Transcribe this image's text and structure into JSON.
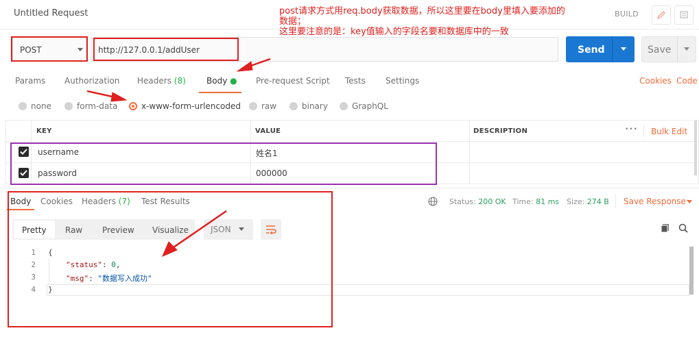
{
  "request": {
    "title": "Untitled Request",
    "build_label": "BUILD",
    "method": "POST",
    "url": "http://127.0.0.1/addUser",
    "send_label": "Send",
    "save_label": "Save"
  },
  "annotation": {
    "line1": "post请求方式用req.body获取数据，所以这里要在body里填入要添加的数据；",
    "line2": "这里要注意的是：key值输入的字段名要和数据库中的一致"
  },
  "tabs": {
    "params": "Params",
    "authorization": "Authorization",
    "headers": "Headers",
    "headers_count": "(8)",
    "body": "Body",
    "prerequest": "Pre-request Script",
    "tests": "Tests",
    "settings": "Settings",
    "cookies": "Cookies",
    "code": "Code"
  },
  "body_types": {
    "none": "none",
    "form_data": "form-data",
    "urlencoded": "x-www-form-urlencoded",
    "raw": "raw",
    "binary": "binary",
    "graphql": "GraphQL",
    "selected": "x-www-form-urlencoded"
  },
  "table": {
    "col_key": "KEY",
    "col_value": "VALUE",
    "col_description": "DESCRIPTION",
    "more": "•••",
    "bulk_edit": "Bulk Edit",
    "rows": [
      {
        "key": "username",
        "value": "姓名1",
        "checked": true
      },
      {
        "key": "password",
        "value": "000000",
        "checked": true
      }
    ]
  },
  "response": {
    "tabs": {
      "body": "Body",
      "cookies": "Cookies",
      "headers": "Headers",
      "headers_count": "(7)",
      "test_results": "Test Results"
    },
    "status_label": "Status:",
    "status_value": "200 OK",
    "time_label": "Time:",
    "time_value": "81 ms",
    "size_label": "Size:",
    "size_value": "274 B",
    "save_response": "Save Response",
    "views": {
      "pretty": "Pretty",
      "raw": "Raw",
      "preview": "Preview",
      "visualize": "Visualize"
    },
    "format": "JSON",
    "lines": [
      {
        "num": "1",
        "text": "{"
      },
      {
        "num": "2",
        "key": "\"status\"",
        "colon": ": ",
        "value": "0",
        "tail": ","
      },
      {
        "num": "3",
        "key": "\"msg\"",
        "colon": ": ",
        "value": "\"数据写入成功\"",
        "tail": ""
      },
      {
        "num": "4",
        "text": "}"
      }
    ]
  },
  "colors": {
    "accent": "#f26b3a",
    "send": "#1a78d2",
    "annotation": "#e0201e",
    "highlight_purple": "#9b30b0",
    "status_ok": "#2a9d5c"
  },
  "icons": {
    "edit": "pencil-icon",
    "comments": "comment-icon",
    "globe": "globe-icon",
    "copy": "copy-icon",
    "search": "search-icon",
    "wrap": "wrap-lines-icon"
  }
}
